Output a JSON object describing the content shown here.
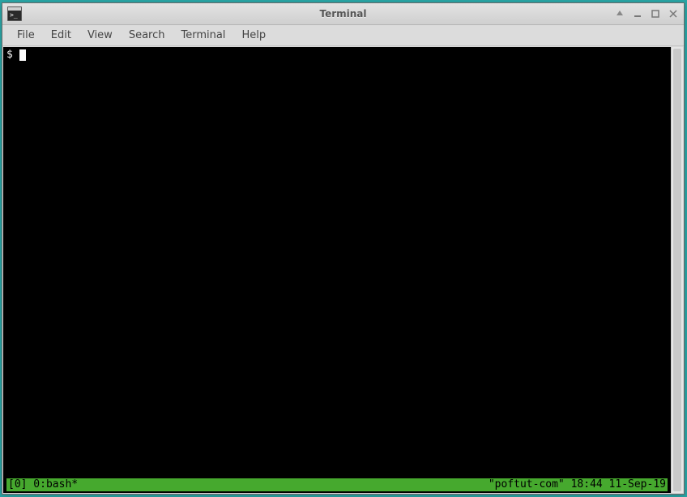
{
  "window": {
    "title": "Terminal"
  },
  "menubar": {
    "items": [
      "File",
      "Edit",
      "View",
      "Search",
      "Terminal",
      "Help"
    ]
  },
  "terminal": {
    "prompt": "$ "
  },
  "status": {
    "left": "[0] 0:bash*",
    "right": "\"poftut-com\" 18:44 11-Sep-19"
  }
}
